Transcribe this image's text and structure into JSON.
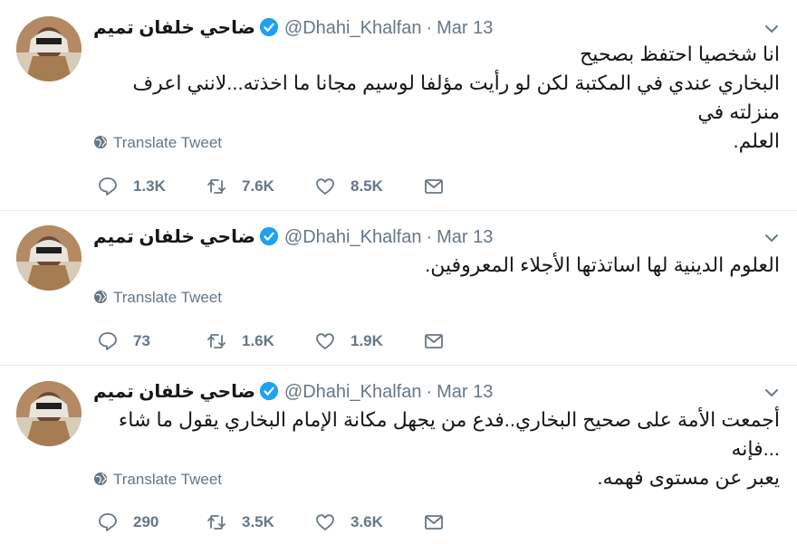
{
  "tweets": [
    {
      "author_name": "ضاحي خلفان تميم",
      "handle": "@Dhahi_Khalfan",
      "separator": "·",
      "date": "Mar 13",
      "text_lines": [
        "انا شخصيا احتفظ بصحيح",
        "البخاري عندي في المكتبة لكن لو رأيت مؤلفا لوسيم مجانا ما اخذته...لانني اعرف منزلته في",
        "العلم."
      ],
      "translate_label": "Translate Tweet",
      "replies": "1.3K",
      "retweets": "7.6K",
      "likes": "8.5K"
    },
    {
      "author_name": "ضاحي خلفان تميم",
      "handle": "@Dhahi_Khalfan",
      "separator": "·",
      "date": "Mar 13",
      "text_lines": [
        "العلوم الدينية لها اساتذتها الأجلاء المعروفين."
      ],
      "translate_label": "Translate Tweet",
      "replies": "73",
      "retweets": "1.6K",
      "likes": "1.9K"
    },
    {
      "author_name": "ضاحي خلفان تميم",
      "handle": "@Dhahi_Khalfan",
      "separator": "·",
      "date": "Mar 13",
      "text_lines": [
        "أجمعت الأمة على صحيح البخاري..فدع من يجهل مكانة الإمام البخاري يقول ما شاء ...فإنه",
        "يعبر عن مستوى فهمه."
      ],
      "translate_label": "Translate Tweet",
      "replies": "290",
      "retweets": "3.5K",
      "likes": "3.6K"
    }
  ],
  "colors": {
    "text": "#14171a",
    "secondary": "#657786",
    "verified": "#1da1f2",
    "divider": "#e6ecf0"
  },
  "icons": {
    "verified": "verified-badge-icon",
    "chevron": "chevron-down-icon",
    "globe": "globe-icon",
    "reply": "reply-icon",
    "retweet": "retweet-icon",
    "like": "heart-icon",
    "dm": "envelope-icon"
  }
}
